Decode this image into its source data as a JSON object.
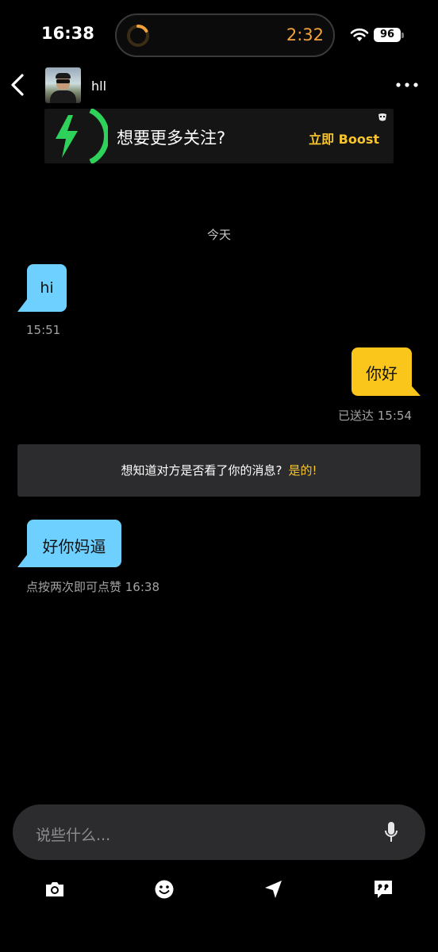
{
  "status_bar": {
    "time": "16:38",
    "live_activity_timer": "2:32",
    "battery": "96"
  },
  "header": {
    "contact_name": "hll"
  },
  "boost_banner": {
    "text": "想要更多关注?",
    "cta": "立即 Boost"
  },
  "chat": {
    "date_label": "今天",
    "messages": [
      {
        "direction": "incoming",
        "text": "hi",
        "meta": "15:51"
      },
      {
        "direction": "outgoing",
        "text": "你好",
        "meta": "已送达 15:54"
      },
      {
        "direction": "incoming",
        "text": "好你妈逼",
        "meta": "点按两次即可点赞 16:38"
      }
    ],
    "read_receipt_prompt": {
      "text": "想知道对方是否看了你的消息?",
      "cta": "是的!"
    }
  },
  "composer": {
    "placeholder": "说些什么..."
  },
  "colors": {
    "incoming_bubble": "#6ed0ff",
    "outgoing_bubble": "#fbc61c",
    "accent_yellow": "#f6c42f",
    "boost_green": "#2ed25a",
    "timer_orange": "#f2a23a"
  },
  "icons": [
    "back-icon",
    "more-icon",
    "bolt-icon",
    "mask-icon",
    "mic-icon",
    "camera-icon",
    "smiley-icon",
    "location-arrow-icon",
    "quote-bubble-icon",
    "wifi-icon",
    "timer-icon"
  ]
}
